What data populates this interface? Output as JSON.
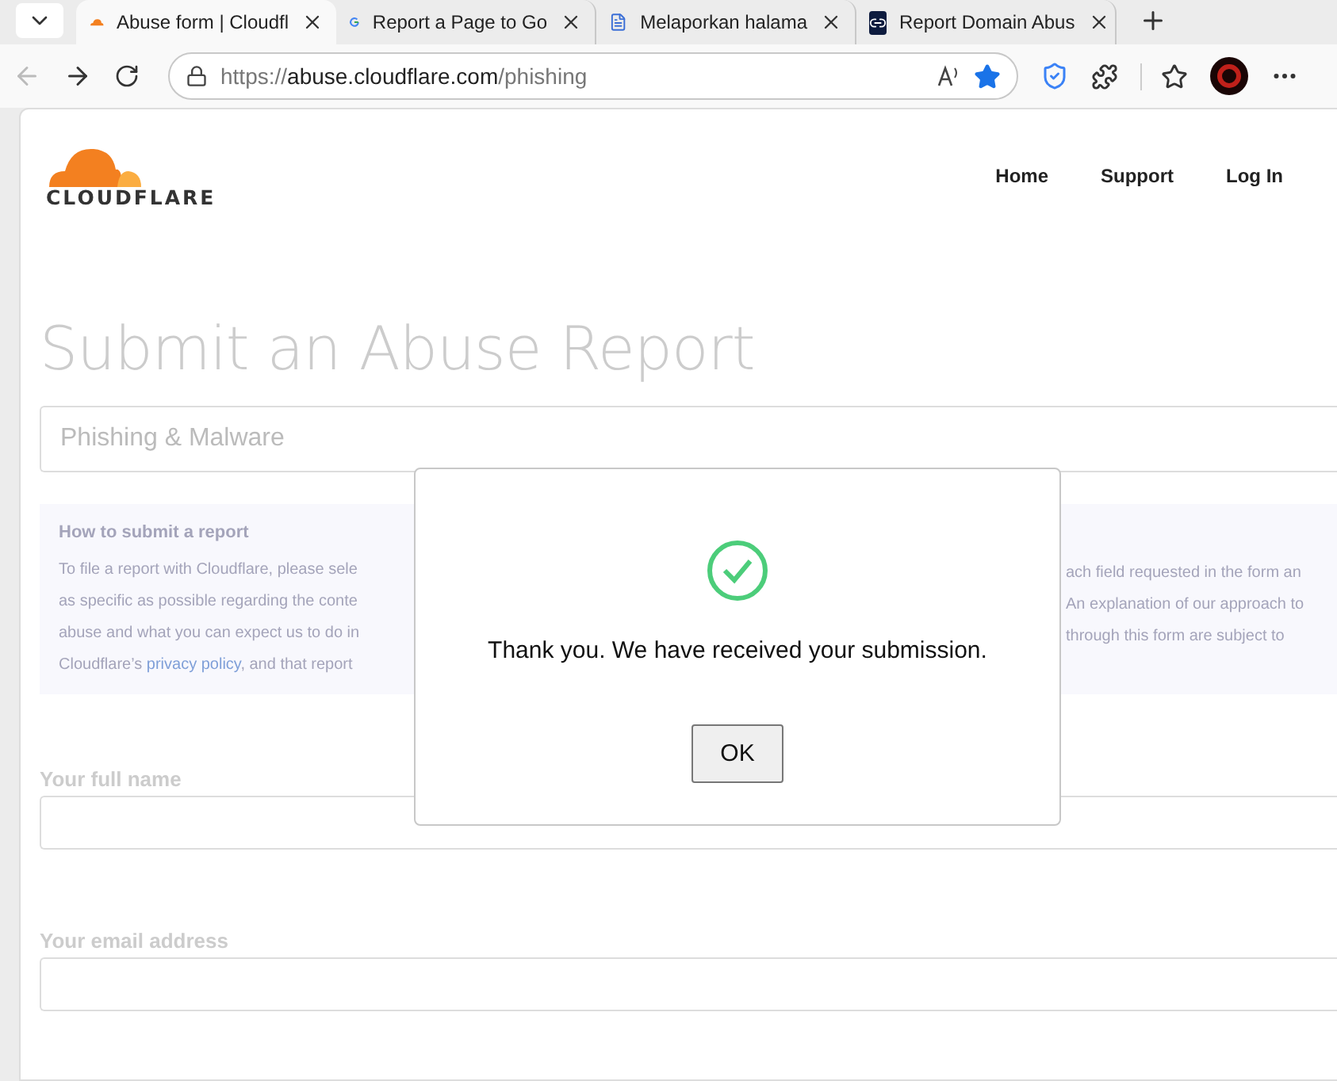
{
  "browser": {
    "tabs": [
      {
        "title": "Abuse form | Cloudfl",
        "selected": true
      },
      {
        "title": "Report a Page to Go",
        "selected": false
      },
      {
        "title": "Melaporkan halama",
        "selected": false
      },
      {
        "title": "Report Domain Abus",
        "selected": false
      }
    ],
    "back_disabled": true,
    "address": {
      "scheme": "https://",
      "host": "abuse.cloudflare.com",
      "path": "/phishing"
    },
    "favorite": true
  },
  "page": {
    "logo_text": "CLOUDFLARE",
    "nav": [
      "Home",
      "Support",
      "Log In"
    ],
    "title": "Submit an Abuse Report",
    "report_type": "Phishing & Malware",
    "info": {
      "heading": "How to submit a report",
      "left_lines": [
        [
          {
            "text": "To file a report with Cloudflare, please sele"
          }
        ],
        [
          {
            "text": "as specific as possible regarding the conte"
          }
        ],
        [
          {
            "text": "abuse and what you can expect us to do in"
          }
        ],
        [
          {
            "text": "Cloudflare’s "
          },
          {
            "text": "privacy policy",
            "link": true
          },
          {
            "text": ", and that report"
          }
        ]
      ],
      "right_lines": [
        "ach field requested in the form an",
        "An explanation of our approach to",
        "through this form are subject to"
      ]
    },
    "fields": [
      {
        "label": "Your full name"
      },
      {
        "label": "Your email address"
      }
    ]
  },
  "dialog": {
    "message": "Thank you. We have received your submission.",
    "button": "OK"
  }
}
